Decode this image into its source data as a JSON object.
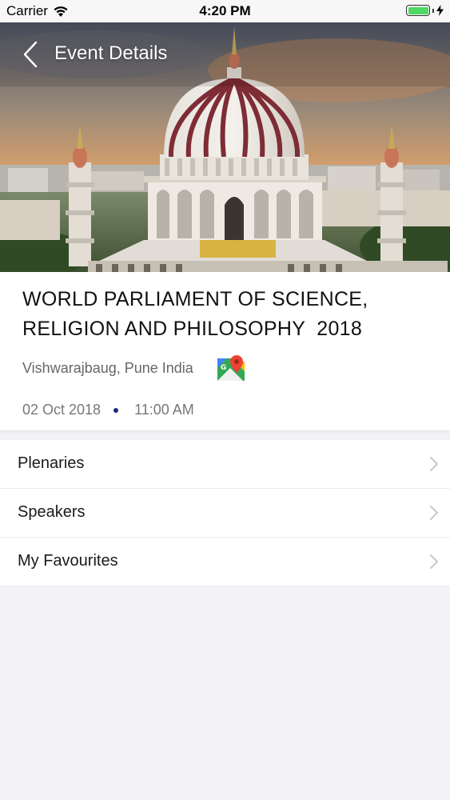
{
  "status_bar": {
    "carrier": "Carrier",
    "time": "4:20 PM"
  },
  "header": {
    "title": "Event Details",
    "back_icon": "chevron-left-icon"
  },
  "event": {
    "title": "WORLD PARLIAMENT OF SCIENCE,\nRELIGION AND PHILOSOPHY  2018",
    "location": "Vishwarajbaug, Pune India",
    "map_icon": "google-maps-icon",
    "date": "02 Oct 2018",
    "time": "11:00 AM"
  },
  "menu": {
    "items": [
      {
        "label": "Plenaries"
      },
      {
        "label": "Speakers"
      },
      {
        "label": "My Favourites"
      }
    ]
  },
  "colors": {
    "dot": "#1f2a78",
    "battery": "#4cd964",
    "background": "#f2f2f7"
  }
}
